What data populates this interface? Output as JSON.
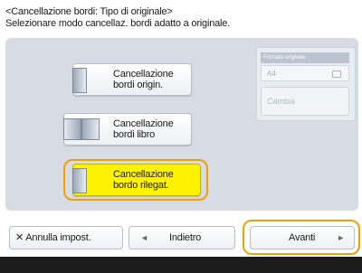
{
  "header": {
    "title": "<Cancellazione bordi: Tipo di originale>",
    "subtitle": "Selezionare modo cancellaz. bordi adatto a originale."
  },
  "options": [
    {
      "line1": "Cancellazione",
      "line2": "bordi origin.",
      "icon": "single-page-document-icon",
      "selected": false
    },
    {
      "line1": "Cancellazione",
      "line2": "bordi libro",
      "icon": "open-book-icon",
      "selected": false
    },
    {
      "line1": "Cancellazione",
      "line2": "bordo rilegat.",
      "icon": "binding-document-icon",
      "selected": true
    }
  ],
  "side_panel": {
    "title": "Formato originale",
    "size_value": "A4",
    "change_label": "Cambia"
  },
  "bottom": {
    "cancel_label": "Annulla impost.",
    "back_label": "Indietro",
    "next_label": "Avanti"
  },
  "colors": {
    "selected": "#fff200",
    "focus_ring": "#f0a000",
    "panel": "#d6dbe4"
  }
}
